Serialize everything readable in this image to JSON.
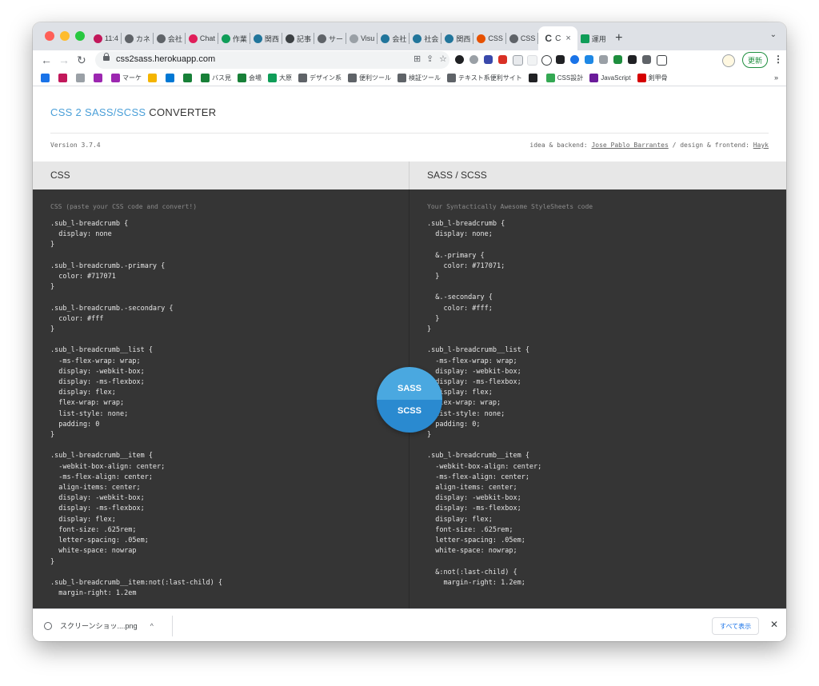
{
  "browser": {
    "tabs": [
      {
        "label": "11:4",
        "color": "#c2185b"
      },
      {
        "label": "カネ",
        "color": "#5f6368"
      },
      {
        "label": "会社",
        "color": "#5f6368"
      },
      {
        "label": "Chat",
        "color": "#e01e5a"
      },
      {
        "label": "作業",
        "color": "#0f9d58"
      },
      {
        "label": "関西",
        "color": "#21759b"
      },
      {
        "label": "記事",
        "color": "#3c4043"
      },
      {
        "label": "サー",
        "color": "#5f6368"
      },
      {
        "label": "Visu",
        "color": "#9aa0a6"
      },
      {
        "label": "会社",
        "color": "#21759b"
      },
      {
        "label": "社会",
        "color": "#21759b"
      },
      {
        "label": "関西",
        "color": "#21759b"
      },
      {
        "label": "CSS",
        "color": "#e65100"
      },
      {
        "label": "CSS",
        "color": "#5f6368"
      }
    ],
    "active_tab": {
      "label": "C",
      "icon_letter": "C"
    },
    "after_tab": {
      "label": "運用",
      "color": "#0f9d58"
    },
    "new_tab_label": "+",
    "tab_search_label": "⌄",
    "url": "css2sass.herokuapp.com",
    "update_button": "更新",
    "bookmarks": [
      {
        "label": "",
        "color": "#1a73e8"
      },
      {
        "label": "",
        "color": "#c2185b"
      },
      {
        "label": "",
        "color": "#9aa0a6"
      },
      {
        "label": "",
        "color": "#9c27b0"
      },
      {
        "label": "マーケ",
        "color": "#9c27b0"
      },
      {
        "label": "",
        "color": "#f4b400"
      },
      {
        "label": "",
        "color": "#0078d4"
      },
      {
        "label": "",
        "color": "#188038"
      },
      {
        "label": "バス見",
        "color": "#188038"
      },
      {
        "label": "会場",
        "color": "#188038"
      },
      {
        "label": "大原",
        "color": "#0f9d58"
      },
      {
        "label": "デザイン系",
        "color": "#5f6368"
      },
      {
        "label": "便利ツール",
        "color": "#5f6368"
      },
      {
        "label": "検証ツール",
        "color": "#5f6368"
      },
      {
        "label": "テキスト系便利サイト",
        "color": "#5f6368"
      },
      {
        "label": "",
        "color": "#202124"
      },
      {
        "label": "CSS設計",
        "color": "#34a853"
      },
      {
        "label": "JavaScript",
        "color": "#6a1b9a"
      },
      {
        "label": "剣甲骨",
        "color": "#d50000"
      }
    ],
    "bookmarks_more": "»"
  },
  "page": {
    "brand_highlight": "CSS 2 SASS/SCSS",
    "brand_rest": " CONVERTER",
    "version": "Version 3.7.4",
    "credits_prefix": "idea & backend: ",
    "credits_backend": "Jose Pablo Barrantes",
    "credits_mid": " / design & frontend: ",
    "credits_frontend": "Hayk",
    "left_title": "CSS",
    "right_title": "SASS / SCSS",
    "left_placeholder": "CSS (paste your CSS code and convert!)",
    "right_placeholder": "Your Syntactically Awesome StyleSheets code",
    "toggle_top": "SASS",
    "toggle_bottom": "SCSS",
    "css_code": ".sub_l-breadcrumb {\n  display: none\n}\n\n.sub_l-breadcrumb.-primary {\n  color: #717071\n}\n\n.sub_l-breadcrumb.-secondary {\n  color: #fff\n}\n\n.sub_l-breadcrumb__list {\n  -ms-flex-wrap: wrap;\n  display: -webkit-box;\n  display: -ms-flexbox;\n  display: flex;\n  flex-wrap: wrap;\n  list-style: none;\n  padding: 0\n}\n\n.sub_l-breadcrumb__item {\n  -webkit-box-align: center;\n  -ms-flex-align: center;\n  align-items: center;\n  display: -webkit-box;\n  display: -ms-flexbox;\n  display: flex;\n  font-size: .625rem;\n  letter-spacing: .05em;\n  white-space: nowrap\n}\n\n.sub_l-breadcrumb__item:not(:last-child) {\n  margin-right: 1.2em",
    "scss_code": ".sub_l-breadcrumb {\n  display: none;\n\n  &.-primary {\n    color: #717071;\n  }\n\n  &.-secondary {\n    color: #fff;\n  }\n}\n\n.sub_l-breadcrumb__list {\n  -ms-flex-wrap: wrap;\n  display: -webkit-box;\n  display: -ms-flexbox;\n  display: flex;\n  flex-wrap: wrap;\n  list-style: none;\n  padding: 0;\n}\n\n.sub_l-breadcrumb__item {\n  -webkit-box-align: center;\n  -ms-flex-align: center;\n  align-items: center;\n  display: -webkit-box;\n  display: -ms-flexbox;\n  display: flex;\n  font-size: .625rem;\n  letter-spacing: .05em;\n  white-space: nowrap;\n\n  &:not(:last-child) {\n    margin-right: 1.2em;"
  },
  "downloads": {
    "file_name": "スクリーンショッ....png",
    "show_all": "すべて表示",
    "close": "✕"
  }
}
